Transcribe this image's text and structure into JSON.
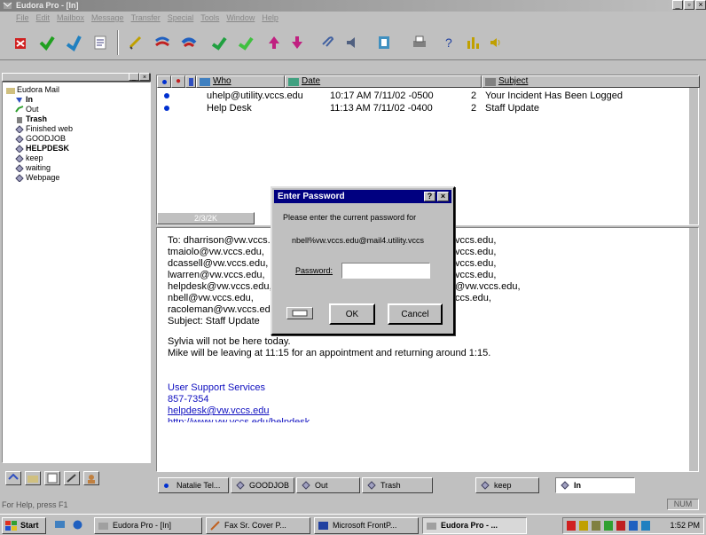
{
  "window": {
    "title": "Eudora Pro - [In]",
    "menu": [
      "File",
      "Edit",
      "Mailbox",
      "Message",
      "Transfer",
      "Special",
      "Tools",
      "Window",
      "Help"
    ]
  },
  "folders": {
    "root": "Eudora Mail",
    "items": [
      {
        "label": "In",
        "bold": true
      },
      {
        "label": "Out",
        "bold": false
      },
      {
        "label": "Trash",
        "bold": true
      },
      {
        "label": "Finished web",
        "bold": false
      },
      {
        "label": "GOODJOB",
        "bold": false
      },
      {
        "label": "HELPDESK",
        "bold": true
      },
      {
        "label": "keep",
        "bold": false
      },
      {
        "label": "waiting",
        "bold": false
      },
      {
        "label": "Webpage",
        "bold": false
      }
    ]
  },
  "message_list": {
    "headers": {
      "who": "Who",
      "date": "Date",
      "subject": "Subject"
    },
    "rows": [
      {
        "who": "uhelp@utility.vccs.edu",
        "date": "10:17 AM 7/11/02 -0500",
        "size": "2",
        "subject": "Your Incident Has Been Logged"
      },
      {
        "who": "Help Desk",
        "date": "11:13 AM 7/11/02 -0400",
        "size": "2",
        "subject": "Staff Update"
      }
    ],
    "count_label": "2/3/2K"
  },
  "preview": {
    "to_lines": [
      "To: dharrison@vw.vccs.edu, ",
      "  tmaiolo@vw.vccs.edu, ",
      "  dcassell@vw.vccs.edu, ",
      "  lwarren@vw.vccs.edu, ",
      "  helpdesk@vw.vccs.edu, ",
      "  nbell@vw.vccs.edu, ",
      "  racoleman@vw.vccs.edu"
    ],
    "to_tail": [
      "vccs.edu,",
      "vccs.edu,",
      "vccs.edu,",
      "vccs.edu,",
      "@vw.vccs.edu,",
      "ccs.edu,"
    ],
    "subject": "Subject: Staff Update",
    "body1": "Sylvia will not be here today.",
    "body2": "Mike will be leaving at 11:15 for an appointment and returning around 1:15.",
    "sig_name": "User Support Services",
    "sig_phone": "857-7354",
    "sig_email": "helpdesk@vw.vccs.edu",
    "sig_url": "http://www.vw.vccs.edu/helpdesk"
  },
  "bottom_tabs": [
    "Natalie Tel...",
    "GOODJOB",
    "Out",
    "Trash",
    "keep",
    "In"
  ],
  "status": {
    "help": "For Help, press F1",
    "num": "NUM"
  },
  "dialog": {
    "title": "Enter Password",
    "prompt": "Please enter the current password for",
    "account": "nbell%vw.vccs.edu@mail4.utility.vccs",
    "password_label": "Password:",
    "password_value": "",
    "ok": "OK",
    "cancel": "Cancel"
  },
  "taskbar": {
    "start": "Start",
    "tasks": [
      "Eudora Pro - [In]",
      "Fax Sr. Cover P...",
      "Microsoft FrontP...",
      "Eudora Pro - ..."
    ],
    "clock": "1:52 PM"
  },
  "colors": {
    "accent": "#000080",
    "unread": "#0030d0",
    "link": "#1010c0"
  }
}
